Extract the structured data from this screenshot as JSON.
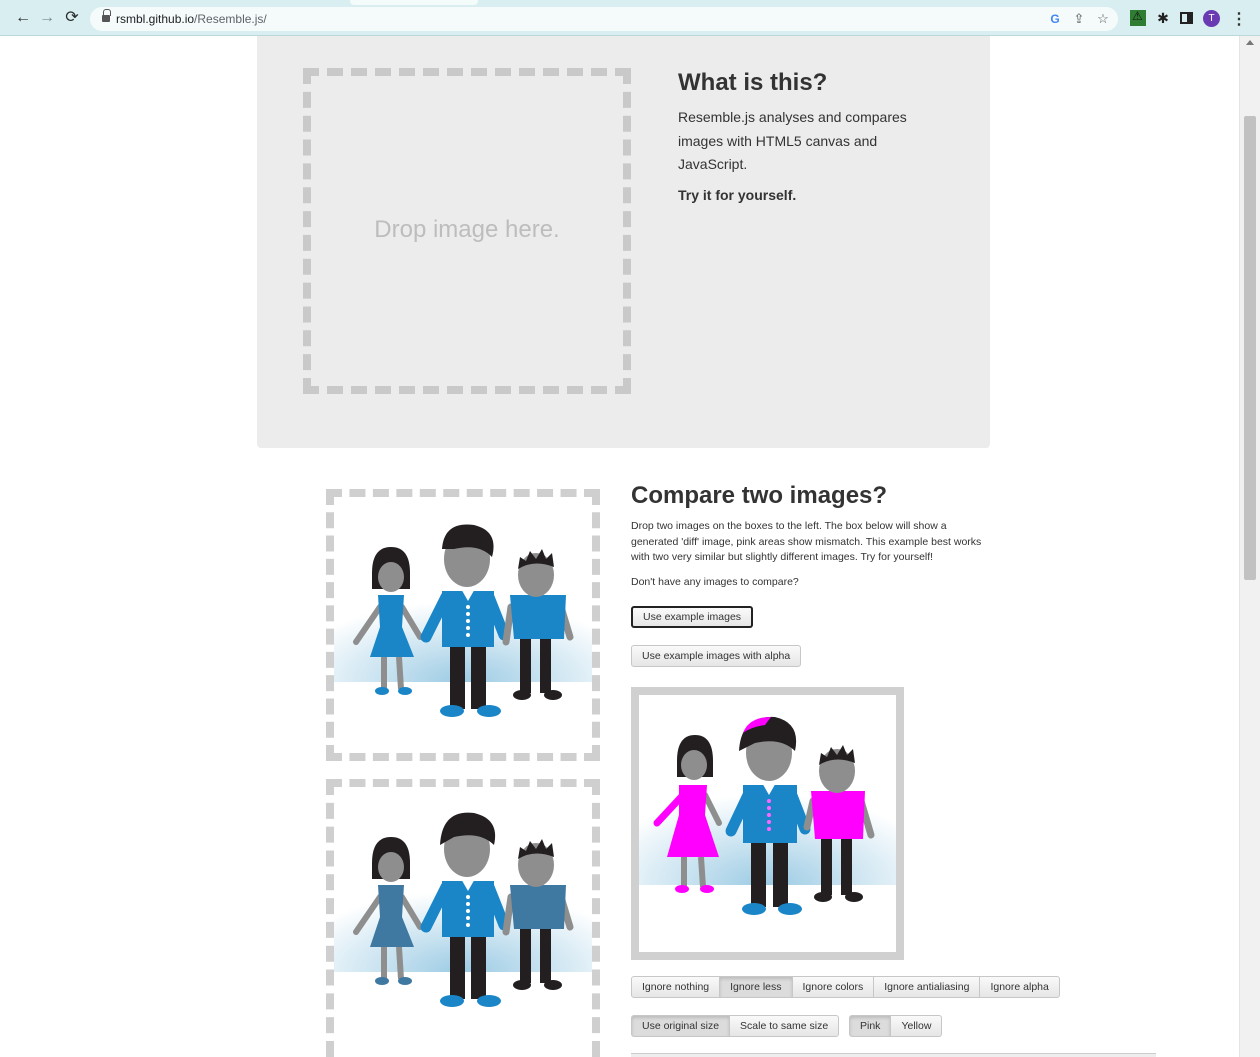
{
  "browser": {
    "url_host": "rsmbl.github.io",
    "url_path": "/Resemble.js/",
    "profile_initial": "T",
    "icons": [
      "back-icon",
      "forward-icon",
      "reload-icon",
      "lock-icon",
      "google-icon",
      "share-icon",
      "star-icon",
      "extension-warning-icon",
      "puzzle-icon",
      "side-panel-icon",
      "kebab-menu-icon"
    ]
  },
  "hero": {
    "drop_text": "Drop image here.",
    "title": "What is this?",
    "description": "Resemble.js analyses and compares images with HTML5 canvas and JavaScript.",
    "try_text": "Try it for yourself."
  },
  "compare": {
    "title": "Compare two images?",
    "description": "Drop two images on the boxes to the left. The box below will show a generated 'diff' image, pink areas show mismatch. This example best works with two very similar but slightly different images. Try for yourself!",
    "question": "Don't have any images to compare?",
    "example_button": "Use example images",
    "example_alpha_button": "Use example images with alpha",
    "ignore_options": [
      "Ignore nothing",
      "Ignore less",
      "Ignore colors",
      "Ignore antialiasing",
      "Ignore alpha"
    ],
    "ignore_active": "Ignore less",
    "size_options": [
      "Use original size",
      "Scale to same size"
    ],
    "size_active": "Use original size",
    "color_options": [
      "Pink",
      "Yellow"
    ],
    "color_active": "Pink"
  },
  "colors": {
    "diff_highlight": "#ff00ff",
    "figure_blue": "#1a86c8",
    "figure_gray": "#8e8e8e",
    "figure_dark": "#231f20"
  }
}
